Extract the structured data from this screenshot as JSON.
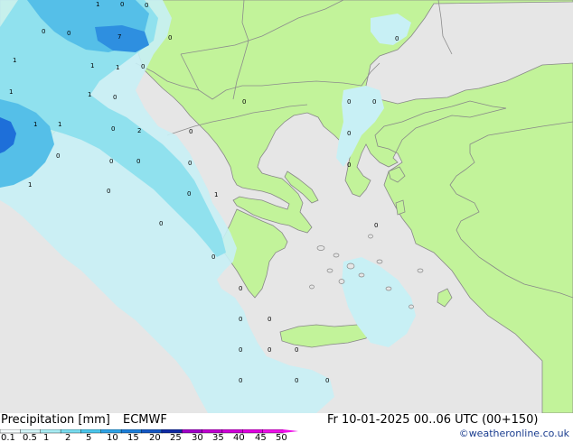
{
  "map": {
    "colors": {
      "sea": "#e6e6e6",
      "land": "#c2f39a",
      "border": "#8c8c8c",
      "coast": "#888888",
      "precip_light": "#c8f0f5",
      "precip_mid": "#90e1ee",
      "precip_heavy": "#55bfe8",
      "precip_strong": "#1e6fd9"
    },
    "labels": [
      "1",
      "1",
      "1",
      "7",
      "1",
      "1",
      "1",
      "1",
      "1",
      "1",
      "1",
      "1",
      "1",
      "2",
      "2",
      "1",
      "1",
      "1",
      "1",
      "1",
      "1",
      "1",
      "1",
      "1",
      "1",
      "1"
    ],
    "zero_marker": "0"
  },
  "footer": {
    "title": "Precipitation [mm]",
    "model": "ECMWF",
    "datetime": "Fr 10-01-2025 00..06 UTC (00+150)",
    "credit": "©weatheronline.co.uk",
    "legend_ticks": [
      "0.1",
      "0.5",
      "1",
      "2",
      "5",
      "10",
      "15",
      "20",
      "25",
      "30",
      "35",
      "40",
      "45",
      "50"
    ],
    "legend_colors": [
      "#f5fdfe",
      "#d2f6f9",
      "#a8ecf3",
      "#78dcef",
      "#4ac6ec",
      "#2ea3e6",
      "#1b7ed9",
      "#1457c4",
      "#0f2aa4",
      "#a000c8",
      "#c000d0",
      "#d000d8",
      "#e000e0",
      "#ee10e8"
    ]
  }
}
